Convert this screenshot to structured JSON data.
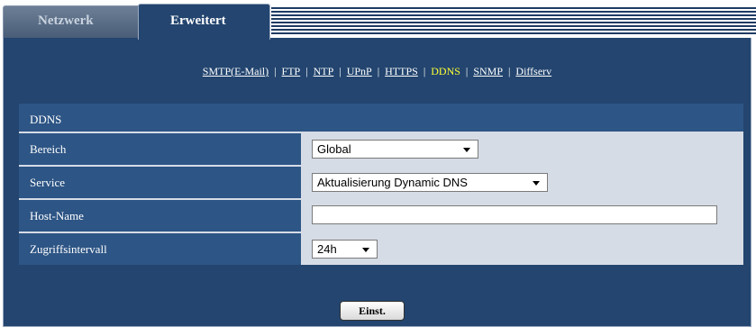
{
  "tabs": {
    "inactive": "Netzwerk",
    "active": "Erweitert"
  },
  "links": [
    "SMTP(E-Mail)",
    "FTP",
    "NTP",
    "UPnP",
    "HTTPS",
    "DDNS",
    "SNMP",
    "Diffserv"
  ],
  "active_link": "DDNS",
  "section": {
    "title": "DDNS"
  },
  "fields": {
    "bereich": {
      "label": "Bereich",
      "value": "Global"
    },
    "service": {
      "label": "Service",
      "value": "Aktualisierung Dynamic DNS"
    },
    "host": {
      "label": "Host-Name",
      "value": ""
    },
    "intervall": {
      "label": "Zugriffsintervall",
      "value": "24h"
    }
  },
  "button": {
    "label": "Einst."
  }
}
